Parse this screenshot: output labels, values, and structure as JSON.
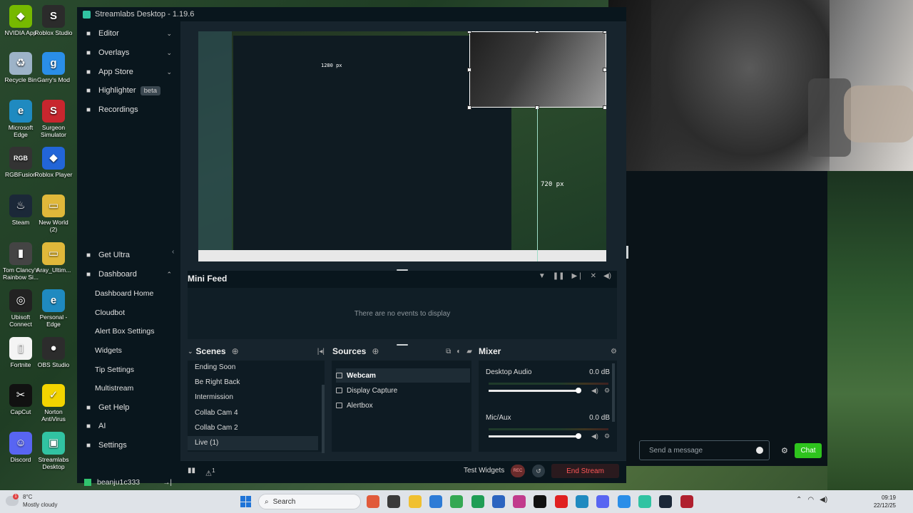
{
  "window": {
    "title": "Streamlabs Desktop - 1.19.6"
  },
  "sidebar": {
    "items": [
      {
        "label": "Editor",
        "icon": "editor-icon",
        "chev": "⌄"
      },
      {
        "label": "Overlays",
        "icon": "overlays-icon",
        "chev": "⌄"
      },
      {
        "label": "App Store",
        "icon": "app-store-icon",
        "chev": "⌄"
      },
      {
        "label": "Highlighter",
        "icon": "highlighter-icon",
        "badge": "beta"
      },
      {
        "label": "Recordings",
        "icon": "recordings-icon"
      },
      {
        "label": "Get Ultra",
        "icon": "ultra-icon"
      },
      {
        "label": "Dashboard",
        "icon": "dashboard-icon",
        "chev": "⌃"
      },
      {
        "label": "Dashboard Home"
      },
      {
        "label": "Cloudbot"
      },
      {
        "label": "Alert Box Settings"
      },
      {
        "label": "Widgets"
      },
      {
        "label": "Tip Settings"
      },
      {
        "label": "Multistream"
      },
      {
        "label": "Get Help",
        "icon": "help-icon"
      },
      {
        "label": "AI",
        "icon": "ai-icon"
      },
      {
        "label": "Settings",
        "icon": "settings-icon"
      }
    ],
    "user": "beanju1c333"
  },
  "preview": {
    "width_label": "1280 px",
    "height_label": "720 px"
  },
  "minifeed": {
    "title": "Mini Feed",
    "empty": "There are no events to display"
  },
  "scenes": {
    "title": "Scenes",
    "items": [
      "Ending Soon",
      "Be Right Back",
      "Intermission",
      "Collab Cam 4",
      "Collab Cam 2",
      "Live (1)"
    ],
    "active": "Live (1)"
  },
  "sources": {
    "title": "Sources",
    "items": [
      "Webcam",
      "Display Capture",
      "Alertbox"
    ],
    "active": "Webcam"
  },
  "mixer": {
    "title": "Mixer",
    "channels": [
      {
        "name": "Desktop Audio",
        "db": "0.0 dB"
      },
      {
        "name": "Mic/Aux",
        "db": "0.0 dB"
      }
    ]
  },
  "footer": {
    "test_widgets": "Test Widgets",
    "rec": "REC",
    "end_stream": "End Stream",
    "alert_count": "1"
  },
  "chat": {
    "placeholder": "Send a message",
    "send": "Chat"
  },
  "desktop_icons": [
    {
      "label": "NVIDIA App",
      "color": "#76b900",
      "glyph": "◆"
    },
    {
      "label": "Roblox Studio",
      "color": "#2b2b2b",
      "glyph": "S"
    },
    {
      "label": "Recycle Bin",
      "color": "#9db3c8",
      "glyph": "♻"
    },
    {
      "label": "Garry's Mod",
      "color": "#2a8ee8",
      "glyph": "g"
    },
    {
      "label": "Microsoft Edge",
      "color": "#1f8ac0",
      "glyph": "e"
    },
    {
      "label": "Surgeon Simulator",
      "color": "#c8262e",
      "glyph": "S"
    },
    {
      "label": "RGBFusion",
      "color": "#333333",
      "glyph": "RGB"
    },
    {
      "label": "Roblox Player",
      "color": "#2265d8",
      "glyph": "◆"
    },
    {
      "label": "Steam",
      "color": "#1b2838",
      "glyph": "♨"
    },
    {
      "label": "New World (2)",
      "color": "#e0b83a",
      "glyph": "▭"
    },
    {
      "label": "Tom Clancy's Rainbow Si...",
      "color": "#444444",
      "glyph": "▮"
    },
    {
      "label": "Aray_Ultim...",
      "color": "#e0b83a",
      "glyph": "▭"
    },
    {
      "label": "Ubisoft Connect",
      "color": "#222222",
      "glyph": "◎"
    },
    {
      "label": "Personal - Edge",
      "color": "#1f8ac0",
      "glyph": "e"
    },
    {
      "label": "Fortnite",
      "color": "#f4f4f4",
      "glyph": "▯"
    },
    {
      "label": "OBS Studio",
      "color": "#2c2c2c",
      "glyph": "●"
    },
    {
      "label": "CapCut",
      "color": "#111111",
      "glyph": "✂"
    },
    {
      "label": "Norton AntiVirus",
      "color": "#f3d400",
      "glyph": "✓"
    },
    {
      "label": "Discord",
      "color": "#5865f2",
      "glyph": "☺"
    },
    {
      "label": "Streamlabs Desktop",
      "color": "#31c3a2",
      "glyph": "▣"
    }
  ],
  "taskbar": {
    "weather_temp": "8°C",
    "weather_desc": "Mostly cloudy",
    "weather_badge": "1",
    "search": "Search",
    "time": "09:19",
    "date": "22/12/25"
  }
}
